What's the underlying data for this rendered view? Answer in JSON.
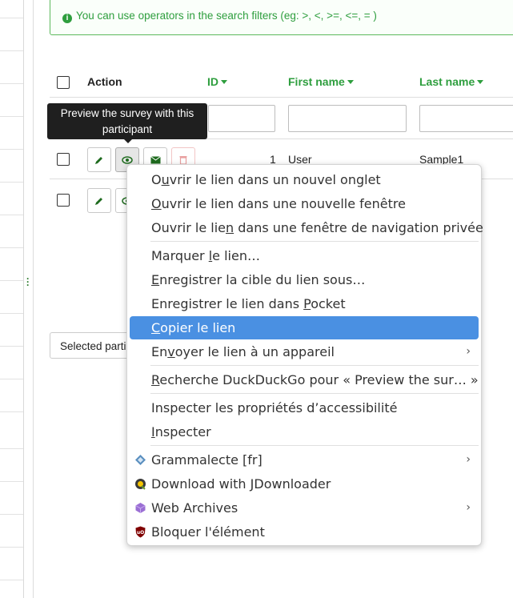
{
  "info": {
    "text": "You can use operators in the search filters (eg: >, <, >=, <=, = )"
  },
  "table": {
    "headers": {
      "action": "Action",
      "id": "ID",
      "first_name": "First name",
      "last_name": "Last name"
    },
    "rows": [
      {
        "id": "1",
        "first_name": "User",
        "last_name": "Sample1"
      }
    ]
  },
  "tooltip": "Preview the survey with this participant",
  "selected_label": "Selected participant(s)...",
  "context_menu": {
    "items": [
      {
        "pre": "O",
        "u": "u",
        "post": "vrir le lien dans un nouvel onglet"
      },
      {
        "pre": "",
        "u": "O",
        "post": "uvrir le lien dans une nouvelle fenêtre"
      },
      {
        "pre": "Ouvrir le lie",
        "u": "n",
        "post": " dans une fenêtre de navigation privée"
      },
      {
        "pre": "Marquer ",
        "u": "l",
        "post": "e lien…"
      },
      {
        "pre": "",
        "u": "E",
        "post": "nregistrer la cible du lien sous…"
      },
      {
        "pre": "Enregistrer le lien dans ",
        "u": "P",
        "post": "ocket"
      },
      {
        "pre": "",
        "u": "C",
        "post": "opier le lien"
      },
      {
        "pre": "En",
        "u": "v",
        "post": "oyer le lien à un appareil"
      },
      {
        "pre": "",
        "u": "R",
        "post": "echerche DuckDuckGo pour « Preview the sur… »"
      },
      {
        "pre": "Inspecter les propriétés d’accessibilité",
        "u": "",
        "post": ""
      },
      {
        "pre": "",
        "u": "I",
        "post": "nspecter"
      },
      {
        "pre": "Grammalecte [fr]",
        "u": "",
        "post": ""
      },
      {
        "pre": "Download with JDownloader",
        "u": "",
        "post": ""
      },
      {
        "pre": "Web Archives",
        "u": "",
        "post": ""
      },
      {
        "pre": "Bloquer l'élément",
        "u": "",
        "post": ""
      }
    ]
  },
  "colors": {
    "accent": "#2e9e3e",
    "highlight": "#4a90e2"
  }
}
